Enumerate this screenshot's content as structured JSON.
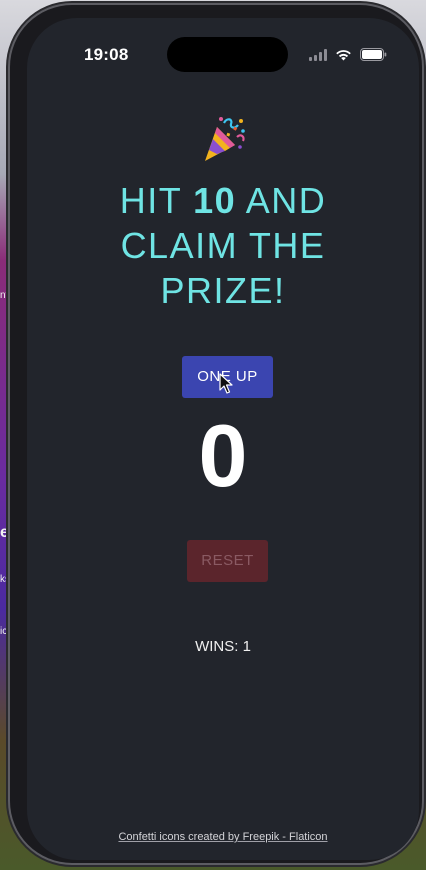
{
  "status_bar": {
    "time": "19:08"
  },
  "app": {
    "icon": "party-popper-icon",
    "title_part1": "HIT ",
    "title_highlight": "10",
    "title_part2": " AND CLAIM THE PRIZE!",
    "one_up_label": "ONE UP",
    "counter_value": "0",
    "reset_label": "RESET",
    "wins_label": "WINS: ",
    "wins_value": "1",
    "credit_text": "Confetti icons created by Freepik - Flaticon"
  },
  "background": {
    "hint_left_1": "nt",
    "hint_left_2": "ks",
    "hint_left_3": "ic",
    "hint_left_4": "e"
  },
  "colors": {
    "screen_bg": "#22252c",
    "title": "#6fe4e4",
    "one_up_bg": "#3b45b0",
    "reset_bg": "#5b252c",
    "reset_text": "#8a5a63"
  }
}
